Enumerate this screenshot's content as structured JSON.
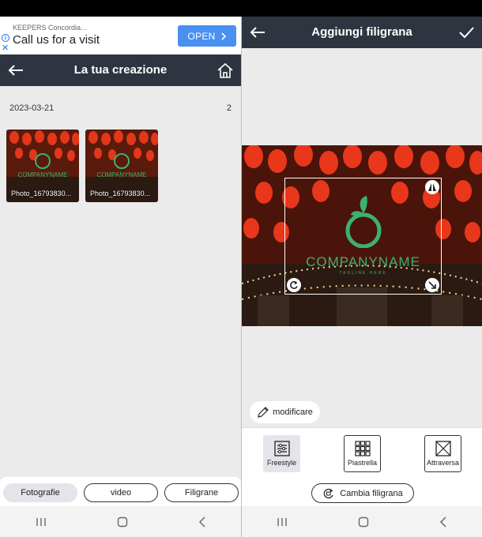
{
  "ad": {
    "advertiser": "KEEPERS Concordia...",
    "headline": "Call us for a visit",
    "cta": "OPEN",
    "info_icon": "info-icon",
    "close_icon": "close-icon"
  },
  "left": {
    "header_title": "La tua creazione",
    "back_icon": "arrow-left-icon",
    "home_icon": "home-icon",
    "group_date": "2023-03-21",
    "group_count": "2",
    "photos": [
      {
        "label": "Photo_16793830..."
      },
      {
        "label": "Photo_16793830..."
      }
    ],
    "tabs": [
      {
        "label": "Fotografie",
        "active": true
      },
      {
        "label": "video",
        "active": false
      },
      {
        "label": "Filigrane",
        "active": false
      }
    ]
  },
  "right": {
    "header_title": "Aggiungi filigrana",
    "back_icon": "arrow-left-icon",
    "confirm_icon": "checkmark-icon",
    "watermark": {
      "company": "COMPANYNAME",
      "tagline": "TAGLINE HERE"
    },
    "modify_label": "modificare",
    "tools": [
      {
        "label": "Freestyle",
        "active": true
      },
      {
        "label": "Piastrella",
        "active": false
      },
      {
        "label": "Attraversa",
        "active": false
      }
    ],
    "change_label": "Cambia filigrana"
  },
  "colors": {
    "header_bg": "#2e3440",
    "ad_button": "#4a90f0",
    "watermark_green": "#3ab36f"
  }
}
